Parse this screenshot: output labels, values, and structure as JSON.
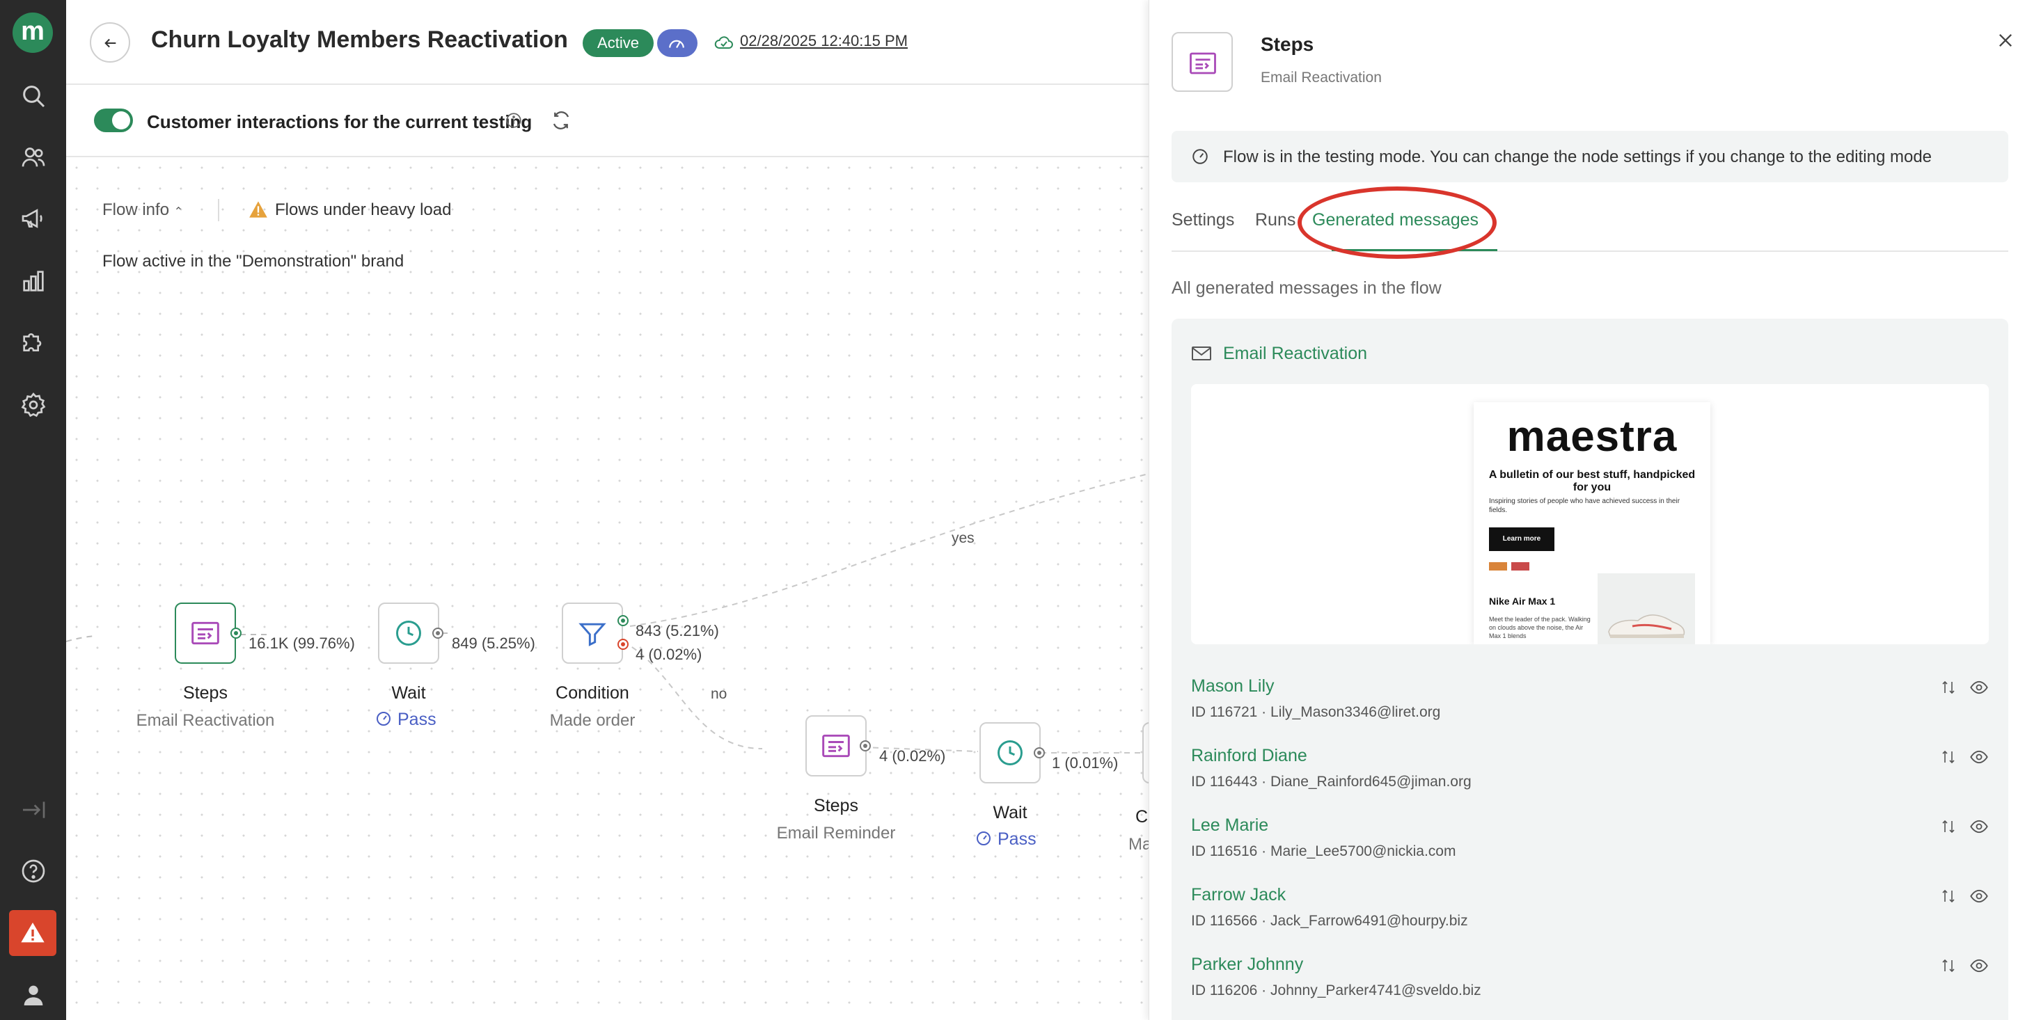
{
  "app": {
    "logo_letter": "m"
  },
  "rail": {
    "icons": [
      "search-icon",
      "users-icon",
      "megaphone-icon",
      "bar-chart-icon",
      "puzzle-icon",
      "gear-icon",
      "logout-arrow-icon",
      "help-icon",
      "alert-icon",
      "profile-icon"
    ]
  },
  "header": {
    "title": "Churn Loyalty Members Reactivation",
    "status": "Active",
    "saved_at": "02/28/2025 12:40:15 PM"
  },
  "testing": {
    "toggle_on": true,
    "label": "Customer interactions for the current testing"
  },
  "canvas": {
    "flow_info": "Flow info",
    "heavy_load": "Flows under heavy load",
    "brand_note": "Flow active in the \"Demonstration\" brand",
    "nodes": {
      "steps1": {
        "title": "Steps",
        "subtitle": "Email Reactivation",
        "count": "16.1K (99.76%)"
      },
      "wait1": {
        "title": "Wait",
        "pass": "Pass",
        "count": "849 (5.25%)"
      },
      "condition": {
        "title": "Condition",
        "subtitle": "Made order",
        "yes_count": "843 (5.21%)",
        "no_count": "4 (0.02%)"
      },
      "steps2": {
        "title": "Steps",
        "subtitle": "Email Reminder",
        "count": "4 (0.02%)"
      },
      "wait2": {
        "title": "Wait",
        "pass": "Pass",
        "count": "1 (0.01%)"
      },
      "partial": {
        "title": "C",
        "subtitle": "Ma"
      }
    },
    "branch_yes": "yes",
    "branch_no": "no"
  },
  "panel": {
    "title": "Steps",
    "subtitle": "Email Reactivation",
    "notice": "Flow is in the testing mode. You can change the node settings if you change to the editing mode",
    "tabs": [
      {
        "label": "Settings",
        "active": false
      },
      {
        "label": "Runs",
        "active": false
      },
      {
        "label": "Generated messages",
        "active": true
      }
    ],
    "section_label": "All generated messages in the flow",
    "card_title": "Email Reactivation",
    "email_preview": {
      "brand": "maestra",
      "headline": "A bulletin of our best stuff, handpicked for you",
      "intro": "Inspiring stories of people who have achieved success in their fields.",
      "cta": "Learn more",
      "product": "Nike Air Max 1",
      "product_desc": "Meet the leader of the pack. Walking on clouds above the noise, the Air Max 1 blends"
    },
    "recipients": [
      {
        "name": "Mason Lily",
        "meta": "ID 116721 · Lily_Mason3346@liret.org"
      },
      {
        "name": "Rainford Diane",
        "meta": "ID 116443 · Diane_Rainford645@jiman.org"
      },
      {
        "name": "Lee Marie",
        "meta": "ID 116516 · Marie_Lee5700@nickia.com"
      },
      {
        "name": "Farrow Jack",
        "meta": "ID 116566 · Jack_Farrow6491@hourpy.biz"
      },
      {
        "name": "Parker Johnny",
        "meta": "ID 116206 · Johnny_Parker4741@sveldo.biz"
      }
    ]
  },
  "colors": {
    "brand_green": "#2c8a5a",
    "accent_blue": "#4a5fc4",
    "alert_red": "#d9452c",
    "steps_purple": "#a94ab8",
    "wait_teal": "#2a9d8f",
    "filter_blue": "#3b6fc9"
  }
}
